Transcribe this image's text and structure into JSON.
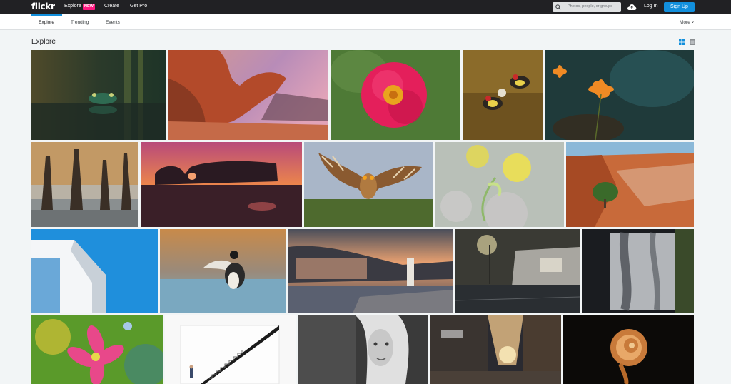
{
  "topbar": {
    "logo": "flickr",
    "nav": {
      "explore": "Explore",
      "new_badge": "NEW",
      "create": "Create",
      "get_pro": "Get Pro"
    },
    "search_placeholder": "Photos, people, or groups",
    "login": "Log In",
    "signup": "Sign Up"
  },
  "subnav": {
    "tabs": [
      "Explore",
      "Trending",
      "Events"
    ],
    "active_tab": "Explore",
    "more": "More ˅"
  },
  "page": {
    "title": "Explore"
  },
  "colors": {
    "topbar_bg": "#212124",
    "accent_blue": "#128fdc",
    "new_badge": "#ff1981",
    "page_bg": "#f2f5f6"
  },
  "photos": [
    {
      "name": "frog-in-water",
      "row": 1
    },
    {
      "name": "red-rock-arch-sunset",
      "row": 1
    },
    {
      "name": "pink-rose",
      "row": 1
    },
    {
      "name": "goldfinches-fighting",
      "row": 1
    },
    {
      "name": "orange-flowers-dark",
      "row": 1
    },
    {
      "name": "misty-cypress-forest",
      "row": 2
    },
    {
      "name": "sea-arch-sunset",
      "row": 2
    },
    {
      "name": "owl-spreading-wings",
      "row": 2
    },
    {
      "name": "snowdrop-bokeh",
      "row": 2
    },
    {
      "name": "red-canyon-tree",
      "row": 2
    },
    {
      "name": "white-building-blue-sky",
      "row": 3
    },
    {
      "name": "duck-flapping-water",
      "row": 3
    },
    {
      "name": "coastal-town-dusk",
      "row": 3
    },
    {
      "name": "street-lamp-houses-night",
      "row": 3
    },
    {
      "name": "shadow-on-wall",
      "row": 3
    },
    {
      "name": "pink-lily-closeup",
      "row": 4
    },
    {
      "name": "white-staircase-figure",
      "row": 4
    },
    {
      "name": "blonde-woman-bw-portrait",
      "row": 4
    },
    {
      "name": "city-street-sunset",
      "row": 4
    },
    {
      "name": "fern-fiddlehead-spiral",
      "row": 4
    }
  ]
}
